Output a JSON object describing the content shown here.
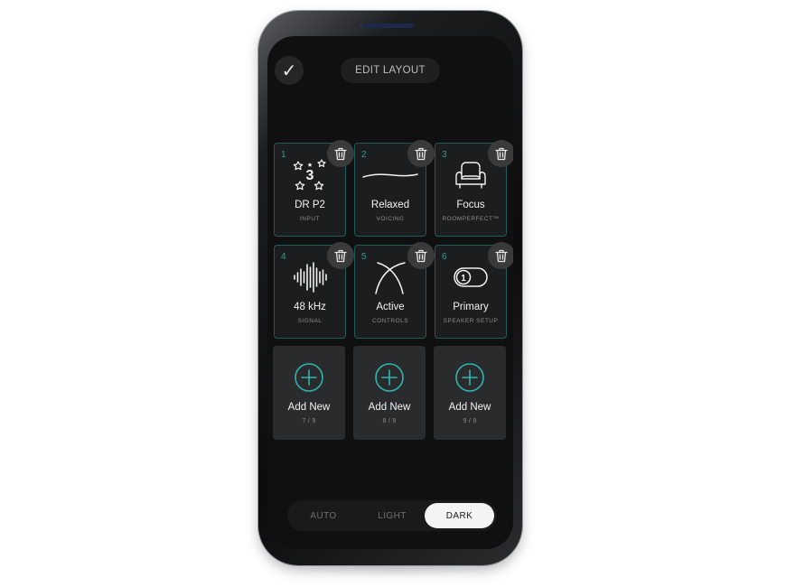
{
  "header": {
    "confirm_icon": "checkmark-icon",
    "confirm_glyph": "✓",
    "title": "EDIT LAYOUT"
  },
  "tiles": [
    {
      "number": "1",
      "label": "DR P2",
      "sub": "INPUT",
      "icon": "stars-3-icon"
    },
    {
      "number": "2",
      "label": "Relaxed",
      "sub": "VOICING",
      "icon": "voicing-curve-icon"
    },
    {
      "number": "3",
      "label": "Focus",
      "sub": "ROOMPERFECT™",
      "icon": "armchair-icon"
    },
    {
      "number": "4",
      "label": "48 kHz",
      "sub": "SIGNAL",
      "icon": "waveform-icon"
    },
    {
      "number": "5",
      "label": "Active",
      "sub": "CONTROLS",
      "icon": "crossing-curves-icon"
    },
    {
      "number": "6",
      "label": "Primary",
      "sub": "SPEAKER SETUP",
      "icon": "toggle-one-icon"
    }
  ],
  "add_tiles": [
    {
      "label": "Add New",
      "sub": "7 / 9"
    },
    {
      "label": "Add New",
      "sub": "8 / 9"
    },
    {
      "label": "Add New",
      "sub": "9 / 9"
    }
  ],
  "stars_badge": "3",
  "toggle_badge": "1",
  "theme": {
    "options": [
      "AUTO",
      "LIGHT",
      "DARK"
    ],
    "selected": "DARK"
  },
  "colors": {
    "accent": "#2fb5b0",
    "tile_border": "#1f5c5c",
    "background": "#101010"
  }
}
